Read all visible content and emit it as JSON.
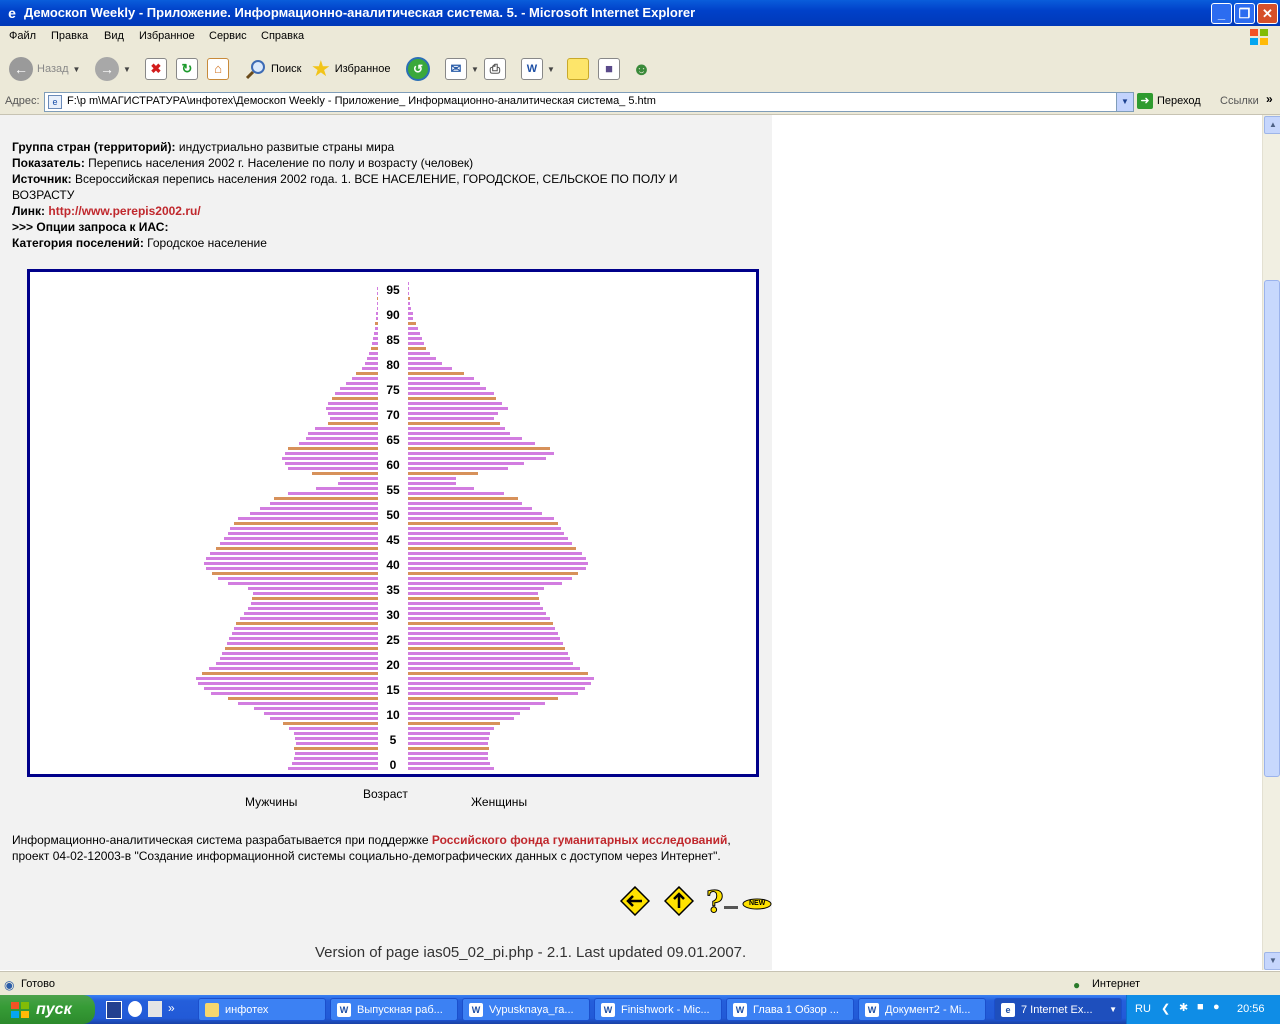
{
  "window": {
    "title": "Демоскоп Weekly - Приложение. Информационно-аналитическая система. 5. - Microsoft Internet Explorer",
    "minimize": "_",
    "maximize": "❐",
    "close": "✕"
  },
  "menu": [
    "Файл",
    "Правка",
    "Вид",
    "Избранное",
    "Сервис",
    "Справка"
  ],
  "toolbar": {
    "back": "Назад",
    "search": "Поиск",
    "favorites": "Избранное"
  },
  "address": {
    "label": "Адрес:",
    "value": "F:\\p m\\МАГИСТРАТУРА\\инфотех\\Демоскоп Weekly - Приложение_ Информационно-аналитическая система_ 5.htm",
    "go": "Переход",
    "links": "Ссылки"
  },
  "info": {
    "group_label": "Группа стран (территорий):",
    "group_value": " индустриально развитые страны мира",
    "indicator_label": "Показатель:",
    "indicator_value": " Перепись населения 2002 г. Население по полу и возрасту (человек)",
    "source_label": "Источник:",
    "source_value_1": " Всероссийская перепись населения 2002 года. 1. ВСЕ НАСЕЛЕНИЕ, ГОРОДСКОЕ, СЕЛЬСКОЕ ПО ПОЛУ И",
    "source_value_2": "ВОЗРАСТУ",
    "link_label": "Линк:",
    "link_value": "http://www.perepis2002.ru/",
    "options": ">>> Опции запроса к ИАС:",
    "category_label": "Категория поселений:",
    "category_value": " Городское население"
  },
  "chart_labels": {
    "men": "Мужчины",
    "age": "Возраст",
    "women": "Женщины"
  },
  "chart_data": {
    "type": "bar",
    "orientation": "horizontal-population-pyramid",
    "age_tick_labels": [
      "0",
      "5",
      "10",
      "15",
      "20",
      "25",
      "30",
      "35",
      "40",
      "45",
      "50",
      "55",
      "60",
      "65",
      "70",
      "75",
      "80",
      "85",
      "90",
      "95"
    ],
    "categories": [
      "0",
      "1",
      "2",
      "3",
      "4",
      "5",
      "6",
      "7",
      "8",
      "9",
      "10",
      "11",
      "12",
      "13",
      "14",
      "15",
      "16",
      "17",
      "18",
      "19",
      "20",
      "21",
      "22",
      "23",
      "24",
      "25",
      "26",
      "27",
      "28",
      "29",
      "30",
      "31",
      "32",
      "33",
      "34",
      "35",
      "36",
      "37",
      "38",
      "39",
      "40",
      "41",
      "42",
      "43",
      "44",
      "45",
      "46",
      "47",
      "48",
      "49",
      "50",
      "51",
      "52",
      "53",
      "54",
      "55",
      "56",
      "57",
      "58",
      "59",
      "60",
      "61",
      "62",
      "63",
      "64",
      "65",
      "66",
      "67",
      "68",
      "69",
      "70",
      "71",
      "72",
      "73",
      "74",
      "75",
      "76",
      "77",
      "78",
      "79",
      "80",
      "81",
      "82",
      "83",
      "84",
      "85",
      "86",
      "87",
      "88",
      "89",
      "90",
      "91",
      "92",
      "93",
      "94",
      "95",
      "96",
      "97",
      "98",
      "99",
      "100"
    ],
    "series": [
      {
        "name": "Мужчины",
        "values": [
          90,
          86,
          84,
          83,
          84,
          82,
          83,
          84,
          89,
          95,
          108,
          114,
          124,
          140,
          150,
          167,
          174,
          180,
          182,
          176,
          169,
          162,
          158,
          156,
          153,
          151,
          149,
          146,
          144,
          142,
          138,
          134,
          130,
          127,
          126,
          125,
          130,
          150,
          160,
          166,
          172,
          174,
          172,
          168,
          162,
          158,
          154,
          150,
          148,
          144,
          140,
          128,
          118,
          108,
          104,
          90,
          62,
          40,
          38,
          66,
          90,
          93,
          96,
          93,
          90,
          79,
          72,
          70,
          63,
          50,
          48,
          50,
          52,
          50,
          46,
          43,
          38,
          32,
          26,
          22,
          16,
          13,
          11,
          9,
          7,
          6,
          5,
          4,
          3,
          3,
          2,
          2,
          1,
          1,
          1,
          1,
          1,
          0,
          0,
          0,
          0
        ]
      },
      {
        "name": "Женщины",
        "values": [
          86,
          82,
          80,
          80,
          81,
          80,
          81,
          82,
          86,
          92,
          106,
          112,
          122,
          137,
          150,
          170,
          177,
          183,
          186,
          180,
          172,
          165,
          162,
          160,
          157,
          155,
          152,
          150,
          147,
          145,
          142,
          138,
          135,
          132,
          131,
          130,
          136,
          154,
          164,
          170,
          178,
          180,
          178,
          174,
          168,
          164,
          160,
          156,
          153,
          150,
          146,
          134,
          124,
          114,
          110,
          96,
          66,
          48,
          48,
          70,
          100,
          116,
          138,
          146,
          142,
          127,
          114,
          102,
          97,
          92,
          86,
          90,
          100,
          94,
          88,
          86,
          78,
          72,
          66,
          56,
          44,
          34,
          28,
          22,
          18,
          16,
          14,
          12,
          10,
          8,
          5,
          5,
          3,
          2,
          2,
          1,
          1,
          1,
          0,
          0,
          0
        ]
      }
    ],
    "highlight_every": 5,
    "colors": {
      "bar": "#d27de0",
      "highlight": "#d7915a",
      "frame": "#00008a"
    },
    "xlabel_left": "Мужчины",
    "xlabel_right": "Женщины",
    "ylabel": "Возраст",
    "legend": "none",
    "grid": false
  },
  "footer": {
    "text_1": "Информационно-аналитическая система разрабатывается при поддержке ",
    "rfh": "Российского фонда гуманитарных исследований",
    "text_2": ",",
    "text_3": "проект 04-02-12003-в \"Создание информационной системы социально-демографических данных с доступом через Интернет\".",
    "version": "Version of page ias05_02_pi.php - 2.1. Last updated 09.01.2007."
  },
  "nav_icons": [
    "back-arrow-icon",
    "up-arrow-icon",
    "help-new-icon"
  ],
  "new_badge": "NEW",
  "status": {
    "text": "Готово",
    "zone": "Интернет"
  },
  "taskbar": {
    "start": "пуск",
    "tasks": [
      {
        "label": "инфотех",
        "icon": "folder-icon"
      },
      {
        "label": "Выпускная раб...",
        "icon": "word-icon"
      },
      {
        "label": "Vypusknaya_ra...",
        "icon": "word-icon"
      },
      {
        "label": "Finishwork - Mic...",
        "icon": "word-icon"
      },
      {
        "label": "Глава 1 Обзор ...",
        "icon": "word-icon"
      },
      {
        "label": "Документ2 - Mi...",
        "icon": "word-icon"
      },
      {
        "label": "7 Internet Ex...",
        "icon": "ie-icon"
      }
    ],
    "lang": "RU",
    "clock": "20:56"
  }
}
